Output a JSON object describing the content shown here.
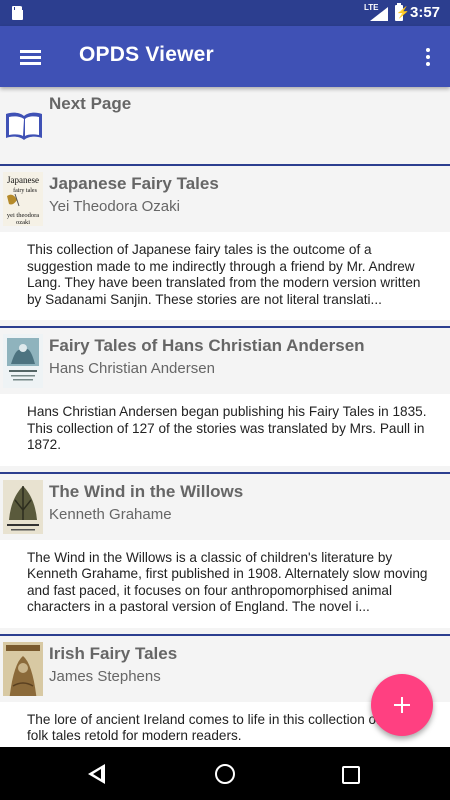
{
  "status_bar": {
    "network": "LTE",
    "time": "3:57",
    "icons": [
      "sd-card-icon",
      "signal-icon",
      "battery-charging-icon"
    ]
  },
  "app_bar": {
    "title": "OPDS Viewer",
    "menu_icon": "hamburger-menu-icon",
    "overflow_icon": "more-vert-icon"
  },
  "list": {
    "next_page": {
      "label": "Next Page",
      "icon": "open-book-icon",
      "accent": "#3f51b5"
    },
    "entries": [
      {
        "title": "Japanese Fairy Tales",
        "author": "Yei Theodora Ozaki",
        "summary": "This collection of Japanese fairy tales is the outcome of a suggestion made to me indirectly through a friend by Mr. Andrew Lang. They have been translated from the modern version written by Sadanami Sanjin. These stories are not literal translati...",
        "cover": {
          "line1": "Japanese",
          "line2": "fairy tales",
          "line3": "yei theodora",
          "line4": "ozaki"
        }
      },
      {
        "title": "Fairy Tales of Hans Christian Andersen",
        "author": "Hans Christian Andersen",
        "summary": "Hans Christian Andersen began publishing his Fairy Tales in 1835. This collection of 127 of the stories was translated by Mrs. Paull in 1872."
      },
      {
        "title": "The Wind in the Willows",
        "author": "Kenneth Grahame",
        "summary": "The Wind in the Willows is a classic of children's literature by Kenneth Grahame, first published in 1908. Alternately slow moving and fast paced, it focuses on four anthropomorphised animal characters in a pastoral version of England. The novel i..."
      },
      {
        "title": "Irish Fairy Tales",
        "author": "James Stephens",
        "summary": "The lore of ancient Ireland comes to life in this collection of classic folk tales retold for modern readers."
      }
    ]
  },
  "fab": {
    "icon": "plus-icon",
    "color": "#ff4081"
  },
  "nav_bar": {
    "icons": [
      "back-icon",
      "home-icon",
      "recents-icon"
    ]
  },
  "colors": {
    "status_bar": "#2c3e8f",
    "app_bar": "#3f51b5",
    "divider": "#2c3e8f"
  }
}
